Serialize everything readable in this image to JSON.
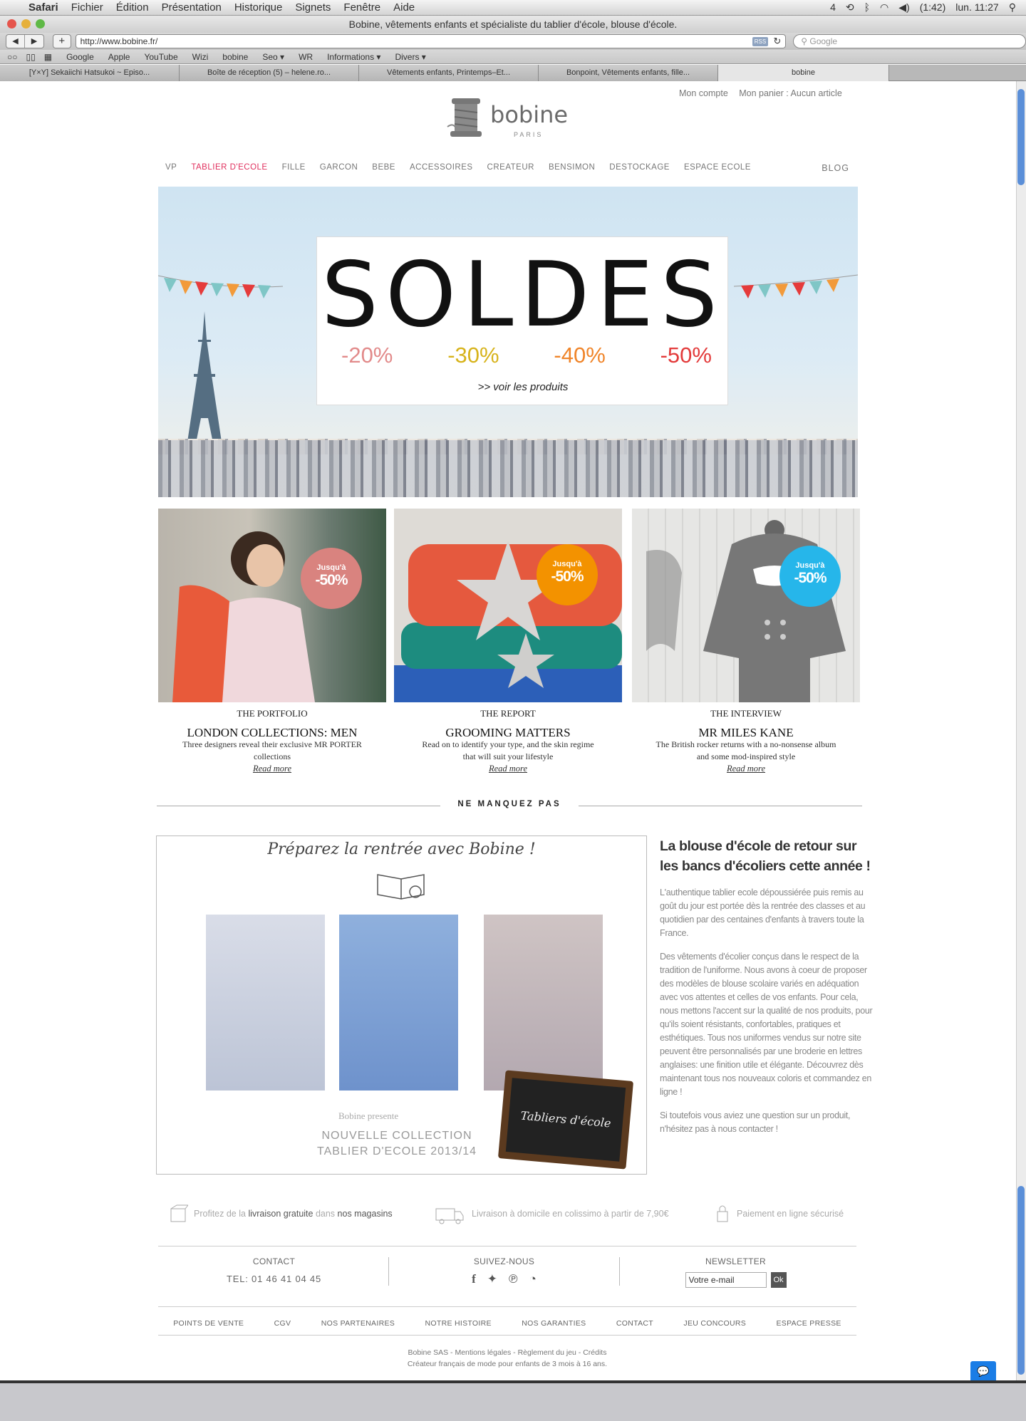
{
  "menubar": {
    "app": "Safari",
    "items": [
      "Fichier",
      "Édition",
      "Présentation",
      "Historique",
      "Signets",
      "Fenêtre",
      "Aide"
    ],
    "status": {
      "battery": "(1:42)",
      "clock": "lun. 11:27",
      "badge": "4"
    }
  },
  "window": {
    "title": "Bobine, vêtements enfants et spécialiste du tablier d'école, blouse d'école."
  },
  "toolbar": {
    "url": "http://www.bobine.fr/",
    "search_placeholder": "Google",
    "rss": "RSS"
  },
  "bookmarks": [
    "Google",
    "Apple",
    "YouTube",
    "Wizi",
    "bobine",
    "Seo ▾",
    "WR",
    "Informations ▾",
    "Divers ▾"
  ],
  "tabs": [
    "[Y×Y] Sekaiichi Hatsukoi ~ Episo...",
    "Boîte de réception (5) – helene.ro...",
    "Vêtements enfants, Printemps–Et...",
    "Bonpoint, Vêtements enfants, fille...",
    "bobine"
  ],
  "site": {
    "account": {
      "mon_compte": "Mon compte",
      "panier": "Mon panier : Aucun article"
    },
    "logo": {
      "word": "bobine",
      "sub": "PARIS"
    },
    "nav": [
      "VP",
      "TABLIER D'ECOLE",
      "FILLE",
      "GARCON",
      "BEBE",
      "ACCESSOIRES",
      "CREATEUR",
      "BENSIMON",
      "DESTOCKAGE",
      "ESPACE ECOLE"
    ],
    "nav_blog": "BLOG",
    "hero": {
      "title": "SOLDES",
      "percents": [
        "-20%",
        "-30%",
        "-40%",
        "-50%"
      ],
      "percent_colors": [
        "#e28a8a",
        "#d7b31b",
        "#f0852a",
        "#e33b3b"
      ],
      "link": ">> voir les produits"
    },
    "cards": [
      {
        "kicker": "THE PORTFOLIO",
        "headline": "LONDON COLLECTIONS: MEN",
        "desc": "Three designers reveal their exclusive MR PORTER collections",
        "more": "Read more",
        "badge_top": "Jusqu'à",
        "badge_value": "-50%",
        "badge_color": "#d9837f"
      },
      {
        "kicker": "THE REPORT",
        "headline": "GROOMING MATTERS",
        "desc": "Read on to identify your type, and the skin regime that will suit your lifestyle",
        "more": "Read more",
        "badge_top": "Jusqu'à",
        "badge_value": "-50%",
        "badge_color": "#f39200"
      },
      {
        "kicker": "THE INTERVIEW",
        "headline": "MR MILES KANE",
        "desc": "The British rocker returns with a no-nonsense album and some mod-inspired style",
        "more": "Read more",
        "badge_top": "Jusqu'à",
        "badge_value": "-50%",
        "badge_color": "#26b6ea"
      }
    ],
    "separator": "NE MANQUEZ PAS",
    "promo": {
      "title": "Préparez la rentrée avec Bobine !",
      "presents": "Bobine presente",
      "collection_line1": "NOUVELLE COLLECTION",
      "collection_line2": "TABLIER D'ECOLE 2013/14",
      "board": "Tabliers d'école"
    },
    "side": {
      "title": "La blouse d'école de retour sur les bancs d'écoliers cette année !",
      "p1": "L'authentique tablier ecole dépoussiérée puis remis au goût du jour est portée dès la rentrée des classes et au quotidien par des centaines d'enfants à travers toute la France.",
      "p2": "Des vêtements d'écolier conçus dans le respect de la tradition de l'uniforme. Nous avons à coeur de proposer des modèles de blouse scolaire variés en adéquation avec vos attentes et celles de vos enfants. Pour cela, nous mettons l'accent sur la qualité de nos produits, pour qu'ils soient résistants, confortables, pratiques et esthétiques. Tous nos uniformes vendus sur notre site peuvent être personnalisés par une broderie en lettres anglaises: une finition utile et élégante. Découvrez dès maintenant tous nos nouveaux coloris et commandez en ligne !",
      "p3": "Si toutefois vous aviez une question sur un produit, n'hésitez pas à nous contacter !"
    },
    "services": {
      "s1_a": "Profitez de la",
      "s1_b": "livraison gratuite",
      "s1_c": "dans",
      "s1_d": "nos magasins",
      "s2": "Livraison à domicile en colissimo à partir de 7,90€",
      "s3": "Paiement en ligne sécurisé"
    },
    "footer": {
      "contact_h": "CONTACT",
      "contact_tel": "TEL: 01 46 41 04 45",
      "follow_h": "SUIVEZ-NOUS",
      "newsletter_h": "NEWSLETTER",
      "newsletter_value": "Votre e-mail",
      "ok": "Ok",
      "links": [
        "POINTS DE VENTE",
        "CGV",
        "NOS PARTENAIRES",
        "NOTRE HISTOIRE",
        "NOS GARANTIES",
        "CONTACT",
        "JEU CONCOURS",
        "ESPACE PRESSE"
      ],
      "legal1": "Bobine SAS - Mentions légales - Règlement du jeu - Crédits",
      "legal2": "Créateur français de mode pour enfants de 3 mois à 16 ans."
    }
  }
}
